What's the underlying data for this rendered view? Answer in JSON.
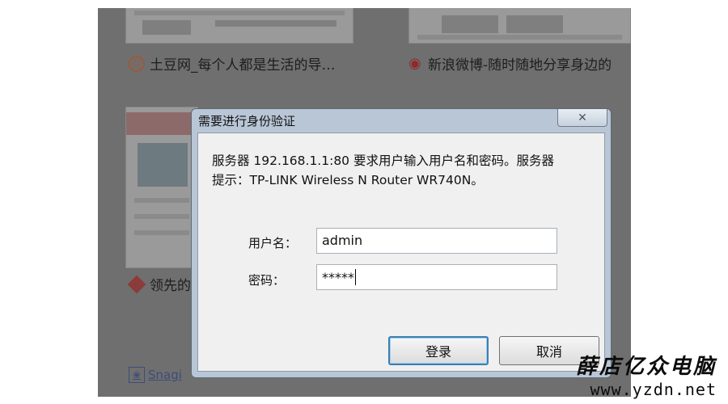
{
  "background_sites": {
    "tudou": {
      "title": "土豆网_每个人都是生活的导…",
      "icon": "tudou-logo-icon"
    },
    "weibo": {
      "title": "新浪微博-随时随地分享身边的",
      "icon": "weibo-logo-icon"
    },
    "lead": {
      "title": "领先的",
      "icon": "diamond-logo-icon"
    },
    "snag": {
      "title": "Snagi",
      "icon": "paw-icon"
    }
  },
  "dialog": {
    "title": "需要进行身份验证",
    "close_glyph": "✕",
    "message_line1": "服务器 192.168.1.1:80 要求用户输入用户名和密码。服务器",
    "message_line2": "提示：TP-LINK Wireless N Router WR740N。",
    "username_label": "用户名：",
    "username_value": "admin",
    "password_label": "密码：",
    "password_value": "*****",
    "login_label": "登录",
    "cancel_label": "取消"
  },
  "watermark": {
    "name": "薛店亿众电脑",
    "url": "www.yzdn.net"
  },
  "colors": {
    "overlay": "#6f6f6f",
    "dialog_frame": "#b8c6d6",
    "default_button_border": "#3c7fb1"
  }
}
